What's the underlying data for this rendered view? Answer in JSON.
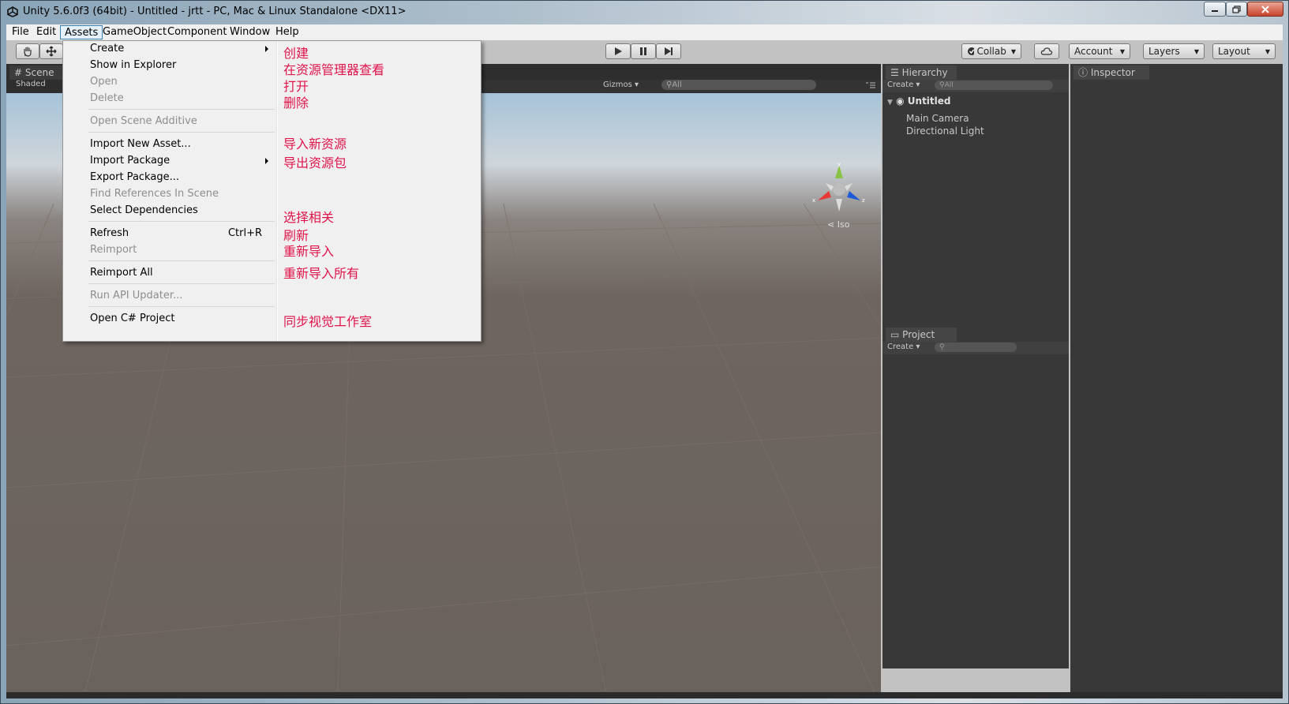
{
  "window": {
    "title": "Unity 5.6.0f3 (64bit) - Untitled - jrtt - PC, Mac & Linux Standalone <DX11>"
  },
  "menubar": {
    "items": [
      "File",
      "Edit",
      "Assets",
      "GameObject",
      "Component",
      "Window",
      "Help"
    ],
    "active": "Assets"
  },
  "toolbar": {
    "collab": "Collab",
    "account": "Account",
    "layers": "Layers",
    "layout": "Layout"
  },
  "scene": {
    "tab": "Scene",
    "mode": "Shaded",
    "gizmos": "Gizmos",
    "search_placeholder": "All",
    "iso": "Iso",
    "axis_labels": {
      "x": "x",
      "y": "y",
      "z": "z"
    }
  },
  "hierarchy": {
    "tab": "Hierarchy",
    "create": "Create",
    "search_placeholder": "All",
    "scene_name": "Untitled",
    "children": [
      "Main Camera",
      "Directional Light"
    ]
  },
  "project": {
    "tab": "Project",
    "create": "Create"
  },
  "inspector": {
    "tab": "Inspector"
  },
  "assets_menu": {
    "items": [
      {
        "label": "Create",
        "disabled": false,
        "submenu": true,
        "note": "创建"
      },
      {
        "label": "Show in Explorer",
        "disabled": false,
        "note": "在资源管理器查看"
      },
      {
        "label": "Open",
        "disabled": true,
        "note": "打开"
      },
      {
        "label": "Delete",
        "disabled": true,
        "note": "删除"
      },
      {
        "label": "Open Scene Additive",
        "disabled": true,
        "note": ""
      },
      {
        "label": "Import New Asset...",
        "disabled": false,
        "note": "导入新资源"
      },
      {
        "label": "Import Package",
        "disabled": false,
        "submenu": true,
        "note": "导出资源包"
      },
      {
        "label": "Export Package...",
        "disabled": false,
        "note": ""
      },
      {
        "label": "Find References In Scene",
        "disabled": true,
        "note": ""
      },
      {
        "label": "Select Dependencies",
        "disabled": false,
        "note": "选择相关"
      },
      {
        "label": "Refresh",
        "disabled": false,
        "shortcut": "Ctrl+R",
        "note": "刷新"
      },
      {
        "label": "Reimport",
        "disabled": true,
        "note": "重新导入"
      },
      {
        "label": "Reimport All",
        "disabled": false,
        "note": "重新导入所有"
      },
      {
        "label": "Run API Updater...",
        "disabled": true,
        "note": ""
      },
      {
        "label": "Open C# Project",
        "disabled": false,
        "note": "同步视觉工作室"
      }
    ]
  },
  "colors": {
    "annotation": "#e0144b",
    "panel_dark": "#383838",
    "toolbar": "#c2c2c2"
  }
}
